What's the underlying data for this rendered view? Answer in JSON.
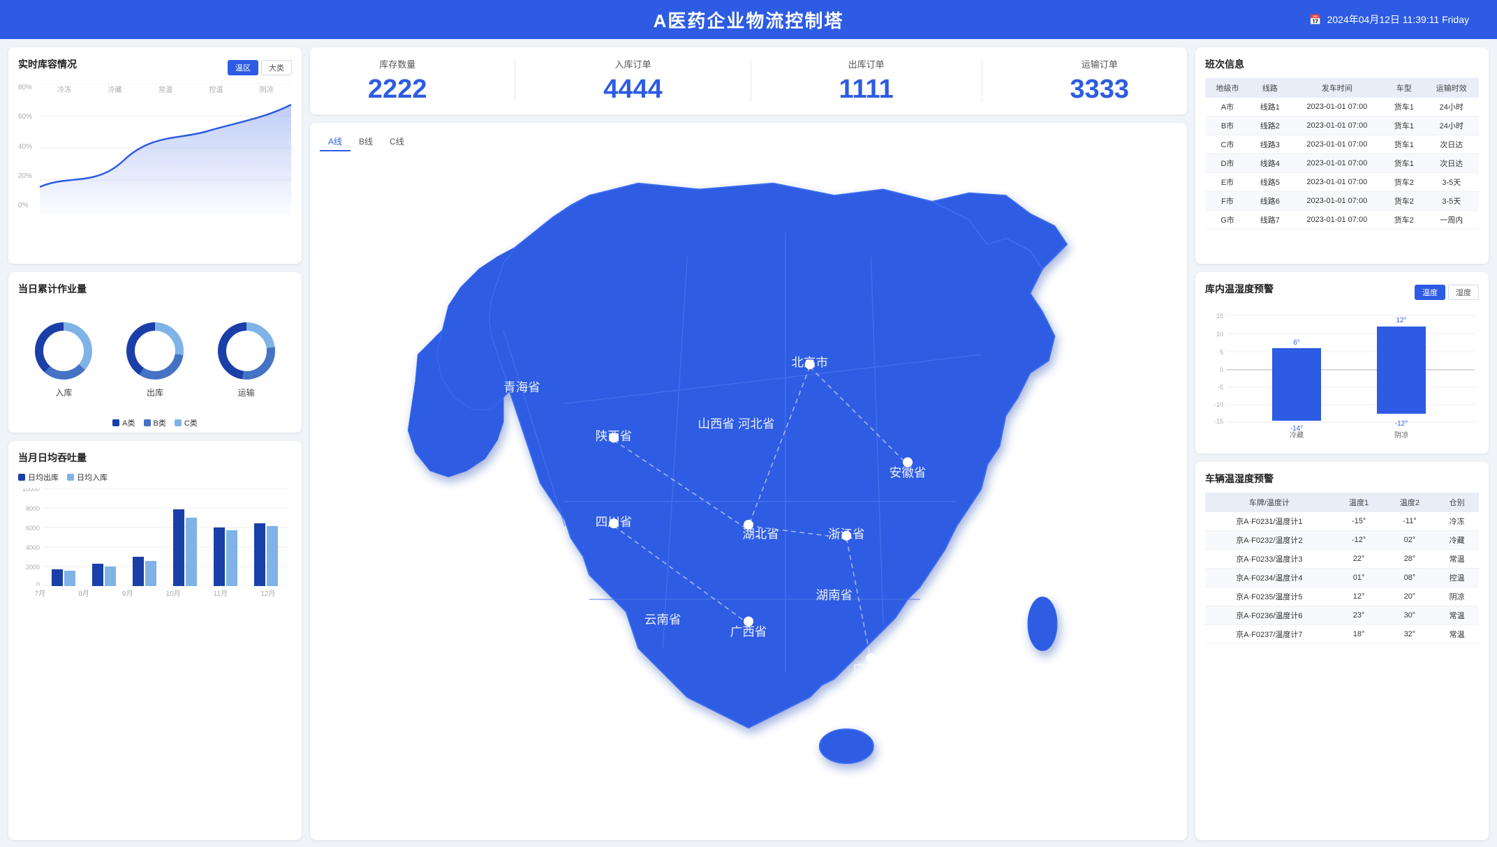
{
  "header": {
    "title": "A医药企业物流控制塔",
    "datetime": "2024年04月12日 11:39:11 Friday",
    "calendar_icon": "📅"
  },
  "inventory": {
    "title": "实时库容情况",
    "tags": [
      "温区",
      "大类"
    ],
    "active_tag": "温区",
    "y_labels": [
      "80%",
      "60%",
      "40%",
      "20%",
      "0%"
    ],
    "x_labels": [
      "冷冻",
      "冷藏",
      "常温",
      "控温",
      "阴凉"
    ]
  },
  "daily_work": {
    "title": "当日累计作业量",
    "items": [
      {
        "label": "入库"
      },
      {
        "label": "出库"
      },
      {
        "label": "运输"
      }
    ],
    "legend": [
      {
        "label": "A类",
        "color": "#1a3fa8"
      },
      {
        "label": "B类",
        "color": "#4472c4"
      },
      {
        "label": "C类",
        "color": "#7fb3e8"
      }
    ]
  },
  "daily_throughput": {
    "title": "当月日均吞吐量",
    "legend": [
      {
        "label": "日均出库",
        "color": "#1a3fa8"
      },
      {
        "label": "日均入库",
        "color": "#7fb3e8"
      }
    ],
    "x_labels": [
      "7月",
      "8月",
      "9月",
      "10月",
      "11月",
      "12月"
    ],
    "y_max": 10000,
    "y_labels": [
      "10000",
      "8000",
      "6000",
      "4000",
      "2000",
      "0"
    ]
  },
  "stats": {
    "items": [
      {
        "label": "库存数量",
        "value": "2222"
      },
      {
        "label": "入库订单",
        "value": "4444"
      },
      {
        "label": "出库订单",
        "value": "1111"
      },
      {
        "label": "运输订单",
        "value": "3333"
      }
    ]
  },
  "map": {
    "tabs": [
      "A线",
      "B线",
      "C线"
    ],
    "active_tab": "A线"
  },
  "route_info": {
    "title": "班次信息",
    "headers": [
      "地级市",
      "线路",
      "发车时间",
      "车型",
      "运输时效"
    ],
    "rows": [
      {
        "city": "A市",
        "route": "线路1",
        "time": "2023-01-01 07:00",
        "car": "货车1",
        "duration": "24小时"
      },
      {
        "city": "B市",
        "route": "线路2",
        "time": "2023-01-01 07:00",
        "car": "货车1",
        "duration": "24小时"
      },
      {
        "city": "C市",
        "route": "线路3",
        "time": "2023-01-01 07:00",
        "car": "货车1",
        "duration": "次日达"
      },
      {
        "city": "D市",
        "route": "线路4",
        "time": "2023-01-01 07:00",
        "car": "货车1",
        "duration": "次日达"
      },
      {
        "city": "E市",
        "route": "线路5",
        "time": "2023-01-01 07:00",
        "car": "货车2",
        "duration": "3-5天"
      },
      {
        "city": "F市",
        "route": "线路6",
        "time": "2023-01-01 07:00",
        "car": "货车2",
        "duration": "3-5天"
      },
      {
        "city": "G市",
        "route": "线路7",
        "time": "2023-01-01 07:00",
        "car": "货车2",
        "duration": "一周内"
      }
    ]
  },
  "warehouse_temp": {
    "title": "库内温湿度预警",
    "tags": [
      "温度",
      "湿度"
    ],
    "active_tag": "温度",
    "categories": [
      "冷藏",
      "阴凉"
    ],
    "bars": [
      {
        "category": "冷藏",
        "high": 6,
        "low": -14,
        "high_label": "6°",
        "low_label": "-14°"
      },
      {
        "category": "阴凉",
        "high": 12,
        "low": -12,
        "high_label": "12°",
        "low_label": "-12°"
      }
    ],
    "y_labels": [
      "15",
      "10",
      "5",
      "0",
      "-5",
      "-10",
      "-15"
    ]
  },
  "vehicle_temp": {
    "title": "车辆温湿度预警",
    "headers": [
      "车牌/温度计",
      "温度1",
      "温度2",
      "仓别"
    ],
    "rows": [
      {
        "plate": "京A·F0231/温度计1",
        "t1": "-15°",
        "t2": "-11°",
        "type": "冷冻"
      },
      {
        "plate": "京A·F0232/温度计2",
        "t1": "-12°",
        "t2": "02°",
        "type": "冷藏"
      },
      {
        "plate": "京A·F0233/温度计3",
        "t1": "22°",
        "t2": "28°",
        "type": "常温"
      },
      {
        "plate": "京A·F0234/温度计4",
        "t1": "01°",
        "t2": "08°",
        "type": "控温"
      },
      {
        "plate": "京A·F0235/温度计5",
        "t1": "12°",
        "t2": "20°",
        "type": "阴凉"
      },
      {
        "plate": "京A·F0236/温度计6",
        "t1": "23°",
        "t2": "30°",
        "type": "常温"
      },
      {
        "plate": "京A·F0237/温度计7",
        "t1": "18°",
        "t2": "32°",
        "type": "常温"
      }
    ]
  }
}
